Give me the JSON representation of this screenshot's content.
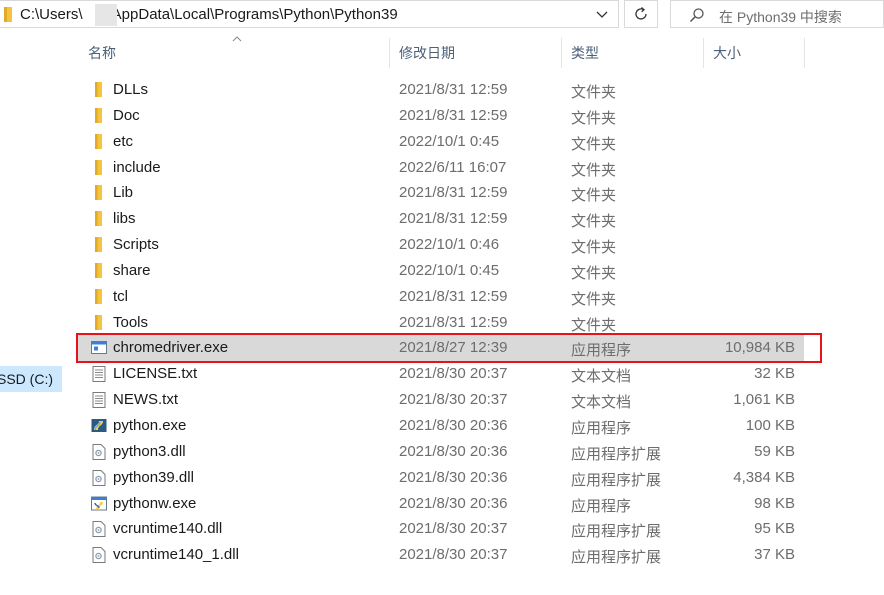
{
  "address_bar": {
    "path": "C:\\Users\\      \\AppData\\Local\\Programs\\Python\\Python39"
  },
  "search": {
    "placeholder": "在 Python39 中搜索"
  },
  "nav": {
    "drive_label": "SSD (C:)"
  },
  "columns": {
    "name": "名称",
    "date": "修改日期",
    "type": "类型",
    "size": "大小"
  },
  "files": [
    {
      "name": "DLLs",
      "date": "2021/8/31 12:59",
      "type": "文件夹",
      "size": "",
      "icon": "folder-icon"
    },
    {
      "name": "Doc",
      "date": "2021/8/31 12:59",
      "type": "文件夹",
      "size": "",
      "icon": "folder-icon"
    },
    {
      "name": "etc",
      "date": "2022/10/1 0:45",
      "type": "文件夹",
      "size": "",
      "icon": "folder-icon"
    },
    {
      "name": "include",
      "date": "2022/6/11 16:07",
      "type": "文件夹",
      "size": "",
      "icon": "folder-icon"
    },
    {
      "name": "Lib",
      "date": "2021/8/31 12:59",
      "type": "文件夹",
      "size": "",
      "icon": "folder-icon"
    },
    {
      "name": "libs",
      "date": "2021/8/31 12:59",
      "type": "文件夹",
      "size": "",
      "icon": "folder-icon"
    },
    {
      "name": "Scripts",
      "date": "2022/10/1 0:46",
      "type": "文件夹",
      "size": "",
      "icon": "folder-icon"
    },
    {
      "name": "share",
      "date": "2022/10/1 0:45",
      "type": "文件夹",
      "size": "",
      "icon": "folder-icon"
    },
    {
      "name": "tcl",
      "date": "2021/8/31 12:59",
      "type": "文件夹",
      "size": "",
      "icon": "folder-icon"
    },
    {
      "name": "Tools",
      "date": "2021/8/31 12:59",
      "type": "文件夹",
      "size": "",
      "icon": "folder-icon"
    },
    {
      "name": "chromedriver.exe",
      "date": "2021/8/27 12:39",
      "type": "应用程序",
      "size": "10,984 KB",
      "icon": "exe-icon",
      "selected": true
    },
    {
      "name": "LICENSE.txt",
      "date": "2021/8/30 20:37",
      "type": "文本文档",
      "size": "32 KB",
      "icon": "text-file-icon"
    },
    {
      "name": "NEWS.txt",
      "date": "2021/8/30 20:37",
      "type": "文本文档",
      "size": "1,061 KB",
      "icon": "text-file-icon"
    },
    {
      "name": "python.exe",
      "date": "2021/8/30 20:36",
      "type": "应用程序",
      "size": "100 KB",
      "icon": "python-icon"
    },
    {
      "name": "python3.dll",
      "date": "2021/8/30 20:36",
      "type": "应用程序扩展",
      "size": "59 KB",
      "icon": "dll-icon"
    },
    {
      "name": "python39.dll",
      "date": "2021/8/30 20:36",
      "type": "应用程序扩展",
      "size": "4,384 KB",
      "icon": "dll-icon"
    },
    {
      "name": "pythonw.exe",
      "date": "2021/8/30 20:36",
      "type": "应用程序",
      "size": "98 KB",
      "icon": "pythonw-icon"
    },
    {
      "name": "vcruntime140.dll",
      "date": "2021/8/30 20:37",
      "type": "应用程序扩展",
      "size": "95 KB",
      "icon": "dll-icon"
    },
    {
      "name": "vcruntime140_1.dll",
      "date": "2021/8/30 20:37",
      "type": "应用程序扩展",
      "size": "37 KB",
      "icon": "dll-icon"
    }
  ],
  "colors": {
    "folder": "#f4c33f",
    "selection": "#d9d9d9",
    "highlight_border": "#e8121b",
    "header_text": "#4c607a"
  }
}
